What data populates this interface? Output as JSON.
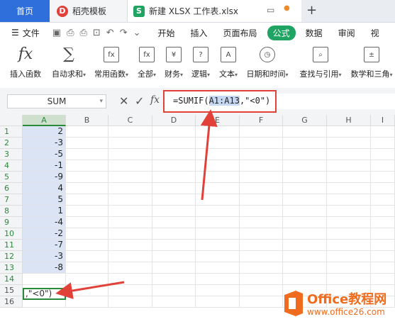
{
  "tabs": {
    "home": "首页",
    "templates": "稻壳模板",
    "file": "新建 XLSX 工作表.xlsx"
  },
  "menu": {
    "file": "文件",
    "items": [
      "开始",
      "插入",
      "页面布局",
      "公式",
      "数据",
      "审阅",
      "视"
    ]
  },
  "ribbon": {
    "buttons": [
      {
        "label": "插入函数",
        "icon": "fx-icon"
      },
      {
        "label": "自动求和",
        "icon": "sigma-icon"
      },
      {
        "label": "常用函数",
        "icon": "star-function-icon"
      },
      {
        "label": "全部",
        "icon": "function-icon"
      },
      {
        "label": "财务",
        "icon": "yen-icon"
      },
      {
        "label": "逻辑",
        "icon": "question-icon"
      },
      {
        "label": "文本",
        "icon": "text-icon"
      },
      {
        "label": "日期和时间",
        "icon": "clock-icon"
      },
      {
        "label": "查找与引用",
        "icon": "lookup-icon"
      },
      {
        "label": "数学和三角",
        "icon": "math-icon"
      }
    ]
  },
  "formula_bar": {
    "name_box": "SUM",
    "fx_label": "fx",
    "formula_prefix": "=SUMIF(",
    "formula_ref": "A1:A13",
    "formula_suffix": ",\"<0\")"
  },
  "grid": {
    "columns": [
      "A",
      "B",
      "C",
      "D",
      "E",
      "F",
      "G",
      "H",
      "I"
    ],
    "rows": [
      "1",
      "2",
      "3",
      "4",
      "5",
      "6",
      "7",
      "8",
      "9",
      "10",
      "11",
      "12",
      "13",
      "14",
      "15",
      "16"
    ],
    "column_a_values": [
      "2",
      "-3",
      "-5",
      "-1",
      "-9",
      "4",
      "5",
      "1",
      "-4",
      "-2",
      "-7",
      "-3",
      "-8"
    ],
    "active_cell_text": ",\"<0\")"
  },
  "watermark": {
    "title": "Office教程网",
    "url": "www.office26.com"
  },
  "colors": {
    "accent_green": "#1fa463",
    "highlight_red": "#e2413a",
    "tab_blue": "#2f6fdc",
    "logo_orange": "#ef6c1f"
  }
}
